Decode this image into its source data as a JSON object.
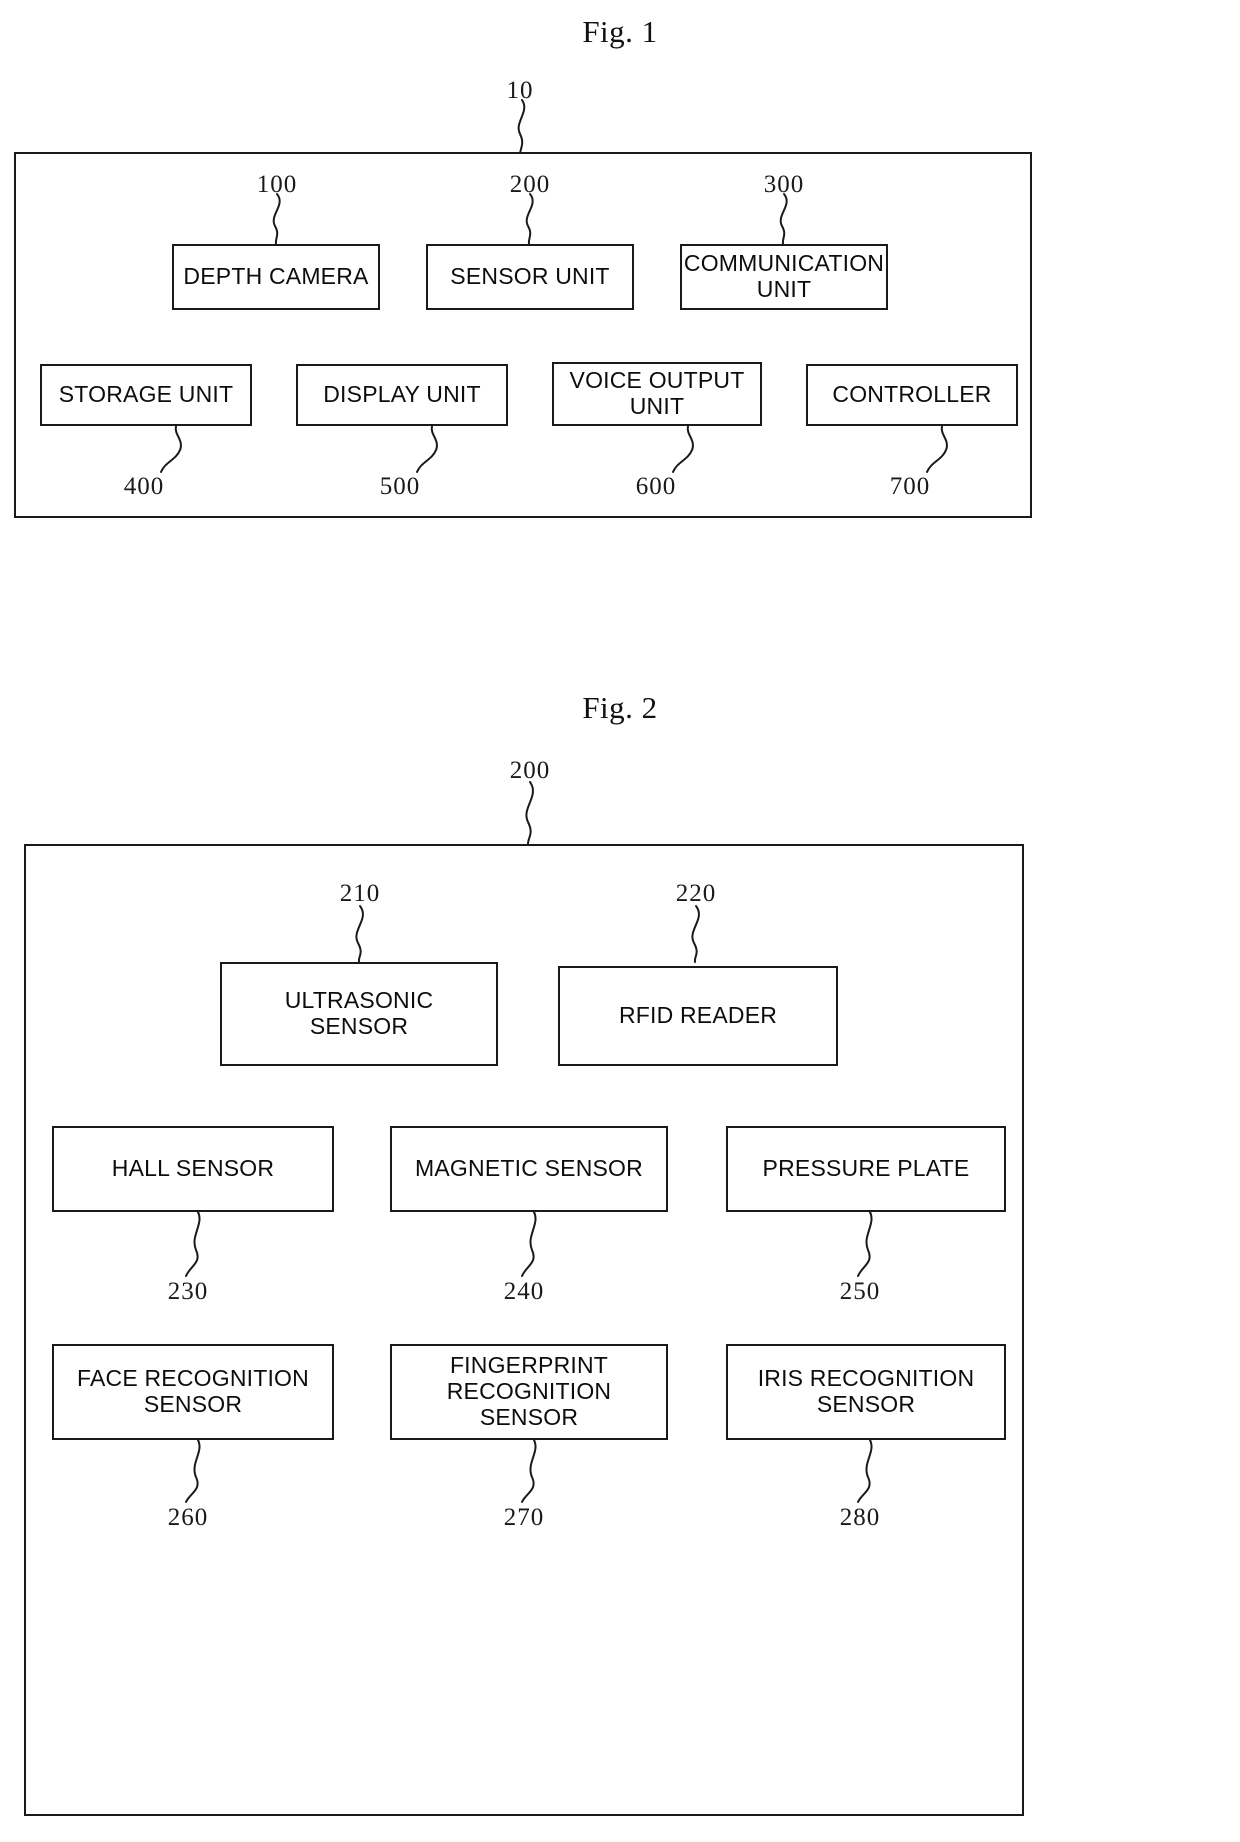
{
  "figures": [
    {
      "title": "Fig. 1",
      "system_ref": "10",
      "nodes": [
        {
          "label": "DEPTH CAMERA",
          "ref": "100"
        },
        {
          "label": "SENSOR UNIT",
          "ref": "200"
        },
        {
          "label": "COMMUNICATION\nUNIT",
          "ref": "300"
        },
        {
          "label": "STORAGE UNIT",
          "ref": "400"
        },
        {
          "label": "DISPLAY UNIT",
          "ref": "500"
        },
        {
          "label": "VOICE OUTPUT\nUNIT",
          "ref": "600"
        },
        {
          "label": "CONTROLLER",
          "ref": "700"
        }
      ]
    },
    {
      "title": "Fig. 2",
      "system_ref": "200",
      "nodes": [
        {
          "label": "ULTRASONIC\nSENSOR",
          "ref": "210"
        },
        {
          "label": "RFID READER",
          "ref": "220"
        },
        {
          "label": "HALL SENSOR",
          "ref": "230"
        },
        {
          "label": "MAGNETIC SENSOR",
          "ref": "240"
        },
        {
          "label": "PRESSURE PLATE",
          "ref": "250"
        },
        {
          "label": "FACE RECOGNITION\nSENSOR",
          "ref": "260"
        },
        {
          "label": "FINGERPRINT\nRECOGNITION\nSENSOR",
          "ref": "270"
        },
        {
          "label": "IRIS RECOGNITION\nSENSOR",
          "ref": "280"
        }
      ]
    }
  ]
}
